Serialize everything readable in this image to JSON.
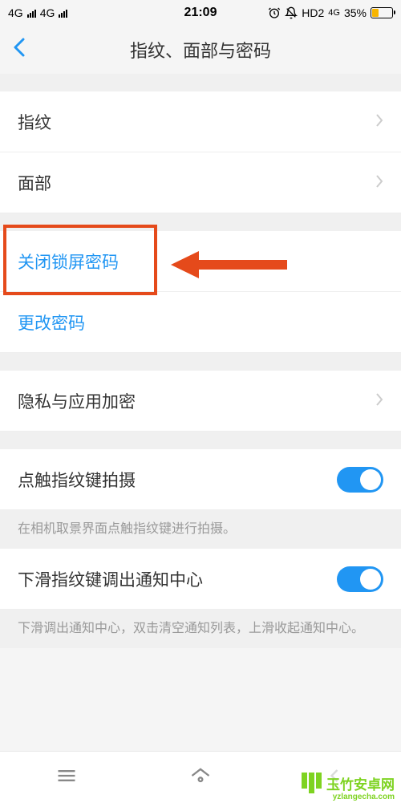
{
  "status": {
    "signal1": "4G",
    "signal2": "4G",
    "time": "21:09",
    "hd": "HD2",
    "net": "4G",
    "battery": "35%"
  },
  "header": {
    "title": "指纹、面部与密码"
  },
  "items": {
    "fingerprint": "指纹",
    "face": "面部",
    "disable_lock": "关闭锁屏密码",
    "change_password": "更改密码",
    "privacy": "隐私与应用加密",
    "touch_shoot": "点触指纹键拍摄",
    "touch_shoot_desc": "在相机取景界面点触指纹键进行拍摄。",
    "swipe_notify": "下滑指纹键调出通知中心",
    "swipe_notify_desc": "下滑调出通知中心，双击清空通知列表，上滑收起通知中心。"
  },
  "watermark": {
    "text": "玉竹安卓网",
    "url": "yzlangecha.com"
  }
}
